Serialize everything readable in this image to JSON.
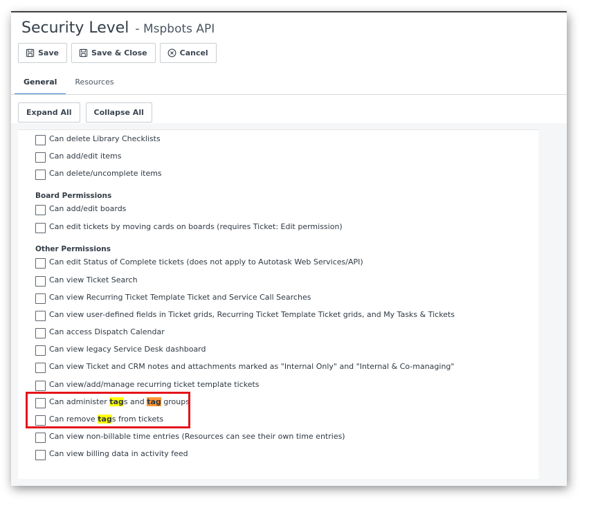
{
  "header": {
    "title": "Security Level",
    "subtitle": "- Mspbots API"
  },
  "toolbar": {
    "save": "Save",
    "save_close": "Save & Close",
    "cancel": "Cancel"
  },
  "tabs": [
    {
      "label": "General"
    },
    {
      "label": "Resources"
    }
  ],
  "controls": {
    "expand_all": "Expand All",
    "collapse_all": "Collapse All"
  },
  "items_top": [
    "Can delete Library Checklists",
    "Can add/edit items",
    "Can delete/uncomplete items"
  ],
  "board": {
    "heading": "Board Permissions",
    "items": [
      "Can add/edit boards",
      "Can edit tickets by moving cards on boards (requires Ticket: Edit permission)"
    ]
  },
  "other": {
    "heading": "Other Permissions",
    "items": [
      "Can edit Status of Complete tickets (does not apply to Autotask Web Services/API)",
      "Can view Ticket Search",
      "Can view Recurring Ticket Template Ticket and Service Call Searches",
      "Can view user-defined fields in Ticket grids, Recurring Ticket Template Ticket grids, and My Tasks & Tickets",
      "Can access Dispatch Calendar",
      "Can view legacy Service Desk dashboard",
      "Can view Ticket and CRM notes and attachments marked as \"Internal Only\" and \"Internal & Co-managing\"",
      "Can view/add/manage recurring ticket template tickets"
    ],
    "tag_admin": {
      "p1": "Can administer ",
      "h1": "tag",
      "p2": "s and ",
      "h2": "tag",
      "p3": " groups"
    },
    "tag_remove": {
      "p1": "Can remove ",
      "h1": "tag",
      "p2": "s from tickets"
    },
    "items_after": [
      "Can view non-billable time entries (Resources can see their own time entries)",
      "Can view billing data in activity feed"
    ]
  },
  "colors": {
    "highlight_primary": "#ffff00",
    "highlight_secondary": "#ff9632",
    "annotation": "#e3151a",
    "tab_accent": "#3b7fc4"
  },
  "icons": {
    "save": "save-icon",
    "save_close": "save-icon",
    "cancel": "cancel-circle-icon"
  }
}
